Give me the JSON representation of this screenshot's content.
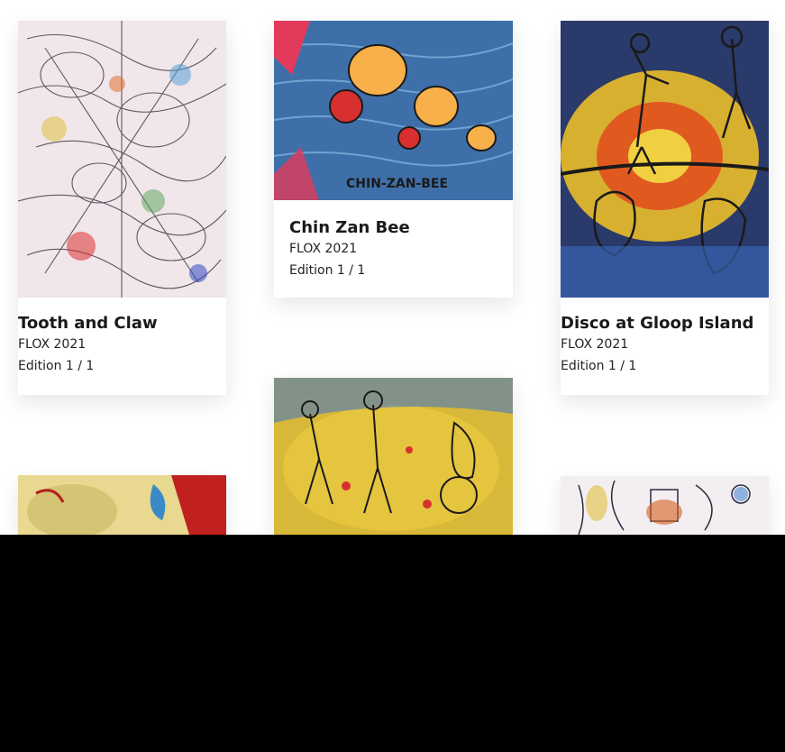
{
  "gallery": {
    "items": [
      {
        "title": "Tooth and Claw",
        "artist": "FLOX 2021",
        "edition": "Edition 1 / 1",
        "art": "tooth-and-claw-artwork"
      },
      {
        "title": "Chin Zan Bee",
        "artist": "FLOX 2021",
        "edition": "Edition 1 / 1",
        "art": "chin-zan-bee-artwork",
        "art_text": "CHIN-ZAN-BEE"
      },
      {
        "title": "Disco at Gloop Island",
        "artist": "FLOX 2021",
        "edition": "Edition 1 / 1",
        "art": "disco-at-gloop-island-artwork"
      },
      {
        "art": "fourth-artwork-partial"
      },
      {
        "art": "fifth-artwork-partial"
      },
      {
        "art": "sixth-artwork-partial"
      }
    ]
  },
  "colors": {
    "overlay": "#000000",
    "title_text": "#1a1a1a"
  }
}
